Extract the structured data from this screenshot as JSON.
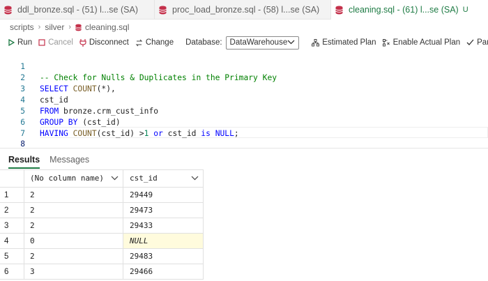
{
  "tabs": [
    {
      "label": "ddl_bronze.sql - (51) l...se (SA)",
      "active": false
    },
    {
      "label": "proc_load_bronze.sql - (58) l...se (SA)",
      "active": false
    },
    {
      "label": "cleaning.sql - (61) l...se (SA)",
      "active": true,
      "modified": "U"
    }
  ],
  "breadcrumb": [
    "scripts",
    "silver",
    "cleaning.sql"
  ],
  "toolbar": {
    "run": "Run",
    "cancel": "Cancel",
    "disconnect": "Disconnect",
    "change": "Change",
    "database_label": "Database:",
    "database_value": "DataWarehouse",
    "estimated_plan": "Estimated Plan",
    "actual_plan": "Enable Actual Plan",
    "parse": "Parse"
  },
  "editor": {
    "line_numbers": [
      "1",
      "2",
      "3",
      "4",
      "5",
      "6",
      "7",
      "8"
    ],
    "lines": {
      "l1": "-- Check for Nulls & Duplicates in the Primary Key",
      "l2_kw": "SELECT ",
      "l2_fn": "COUNT",
      "l2_rest": "(*),",
      "l3": "cst_id",
      "l4_kw": "FROM ",
      "l4_rest": "bronze.crm_cust_info",
      "l5_kw": "GROUP BY ",
      "l5_rest": "(cst_id)",
      "l6_kw": "HAVING ",
      "l6_fn": "COUNT",
      "l6_mid": "(cst_id) >",
      "l6_num": "1",
      "l6_or": " or ",
      "l6_col": "cst_id ",
      "l6_is": "is",
      "l6_sp": " ",
      "l6_null": "NULL",
      "l6_end": ";"
    }
  },
  "results": {
    "tabs": [
      "Results",
      "Messages"
    ],
    "columns": [
      "(No column name)",
      "cst_id"
    ],
    "rows": [
      {
        "n": "1",
        "count": "2",
        "cst_id": "29449"
      },
      {
        "n": "2",
        "count": "2",
        "cst_id": "29473"
      },
      {
        "n": "3",
        "count": "2",
        "cst_id": "29433"
      },
      {
        "n": "4",
        "count": "0",
        "cst_id": "NULL"
      },
      {
        "n": "5",
        "count": "2",
        "cst_id": "29483"
      },
      {
        "n": "6",
        "count": "3",
        "cst_id": "29466"
      }
    ]
  },
  "colors": {
    "accent_green": "#1e7b44",
    "db_icon_red": "#c4314b",
    "keyword_blue": "#0000ff",
    "comment_green": "#008000",
    "null_highlight": "#fffbdd"
  }
}
